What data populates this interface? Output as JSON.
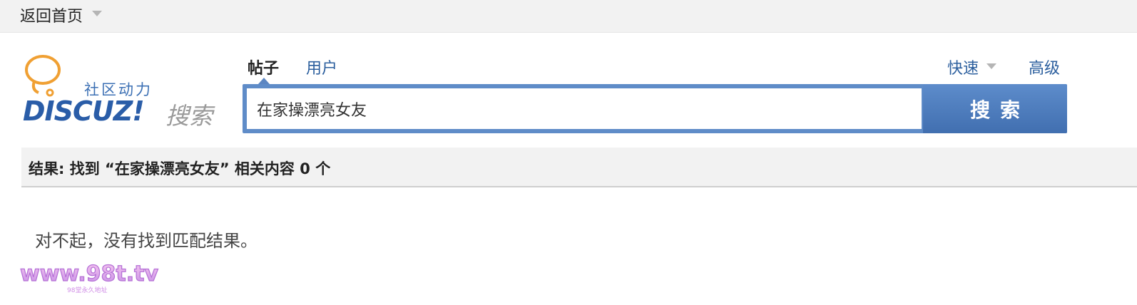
{
  "topbar": {
    "back_home_label": "返回首页",
    "dropdown_icon": "caret-down-icon"
  },
  "logo": {
    "subtitle": "社区动力",
    "wordmark": "DISCUZ!",
    "search_word": "搜索",
    "bubble_icon": "speech-bubble-icon"
  },
  "search": {
    "tabs": [
      {
        "label": "帖子",
        "active": true
      },
      {
        "label": "用户",
        "active": false
      }
    ],
    "quick_label": "快速",
    "advanced_label": "高级",
    "query_value": "在家操漂亮女友",
    "button_label": "搜索",
    "accent_color": "#5f8cc8"
  },
  "results": {
    "summary_prefix": "结果: 找到 “在家操漂亮女友” 相关内容",
    "count": "0",
    "unit": "个",
    "empty_message": "对不起，没有找到匹配结果。"
  },
  "watermark": {
    "domain_text": "www.98t.tv",
    "tagline": "98堂永久地址"
  }
}
